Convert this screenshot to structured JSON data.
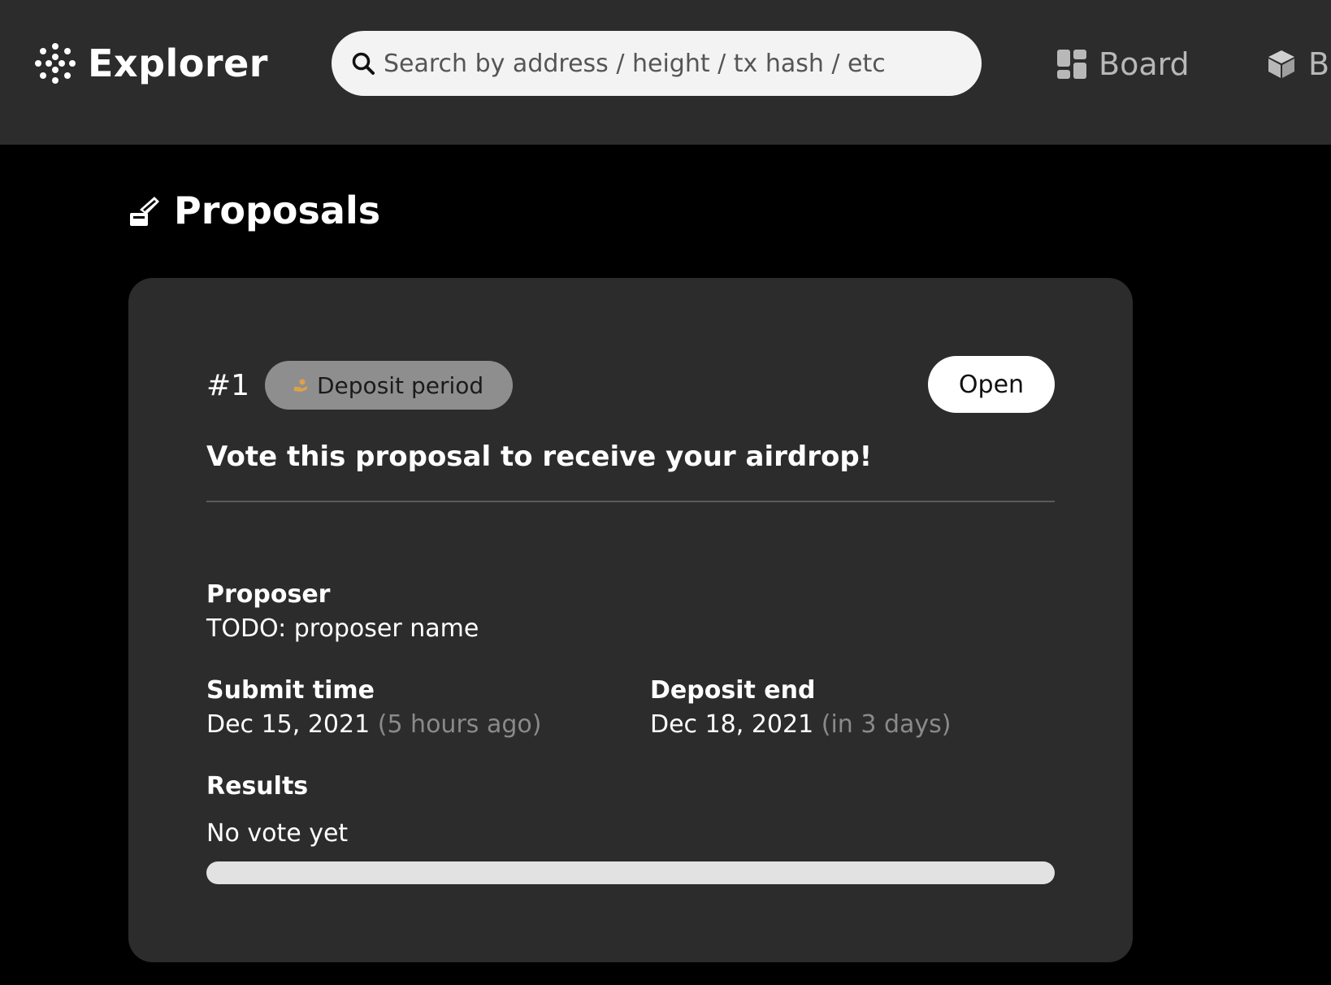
{
  "header": {
    "brand": "Explorer",
    "search_placeholder": "Search by address / height / tx hash / etc",
    "nav": [
      {
        "label": "Board",
        "icon": "dashboard-icon"
      },
      {
        "label": "Bl",
        "icon": "cube-icon"
      }
    ]
  },
  "page": {
    "title": "Proposals",
    "title_icon": "vote-icon"
  },
  "proposal": {
    "id": "#1",
    "status": "Deposit period",
    "status_icon": "hand-coin-icon",
    "open_label": "Open",
    "title": "Vote this proposal to receive your airdrop!",
    "proposer_label": "Proposer",
    "proposer_value": "TODO: proposer name",
    "submit_label": "Submit time",
    "submit_date": "Dec 15, 2021",
    "submit_relative": "(5 hours ago)",
    "deposit_end_label": "Deposit end",
    "deposit_end_date": "Dec 18, 2021",
    "deposit_end_relative": "(in 3 days)",
    "results_label": "Results",
    "results_value": "No vote yet",
    "results_progress": 0
  },
  "colors": {
    "topbar": "#2c2c2c",
    "background": "#000000",
    "card": "#2c2c2c",
    "badge": "#8e8e8e",
    "muted_text": "#8a8a8a"
  }
}
